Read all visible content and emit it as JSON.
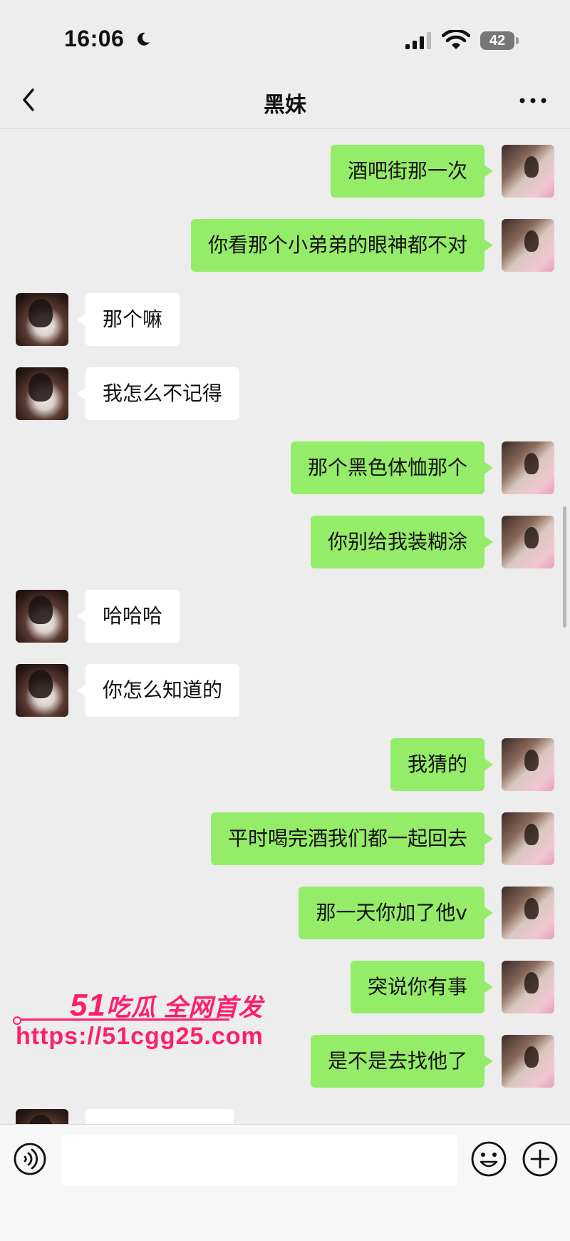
{
  "status_bar": {
    "time": "16:06",
    "battery": "42"
  },
  "header": {
    "title": "黑妹"
  },
  "messages": [
    {
      "side": "mine",
      "text": "酒吧街那一次"
    },
    {
      "side": "mine",
      "text": "你看那个小弟弟的眼神都不对"
    },
    {
      "side": "theirs",
      "text": "那个嘛"
    },
    {
      "side": "theirs",
      "text": "我怎么不记得"
    },
    {
      "side": "mine",
      "text": "那个黑色体恤那个"
    },
    {
      "side": "mine",
      "text": "你别给我装糊涂"
    },
    {
      "side": "theirs",
      "text": "哈哈哈"
    },
    {
      "side": "theirs",
      "text": "你怎么知道的"
    },
    {
      "side": "mine",
      "text": "我猜的"
    },
    {
      "side": "mine",
      "text": "平时喝完酒我们都一起回去"
    },
    {
      "side": "mine",
      "text": "那一天你加了他v"
    },
    {
      "side": "mine",
      "text": "突说你有事"
    },
    {
      "side": "mine",
      "text": "是不是去找他了"
    }
  ],
  "watermark": {
    "logo_num": "51",
    "logo_text": "吃瓜 全网首发",
    "url": "https://51cgg25.com"
  },
  "input": {
    "value": "",
    "placeholder": ""
  },
  "icons": {
    "back": "chevron-left-icon",
    "more": "more-dots-icon",
    "voice": "voice-icon",
    "emoji": "emoji-icon",
    "plus": "plus-icon"
  },
  "colors": {
    "background": "#ededed",
    "my_bubble": "#95ec69",
    "their_bubble": "#ffffff",
    "watermark": "#ff1e6e"
  }
}
